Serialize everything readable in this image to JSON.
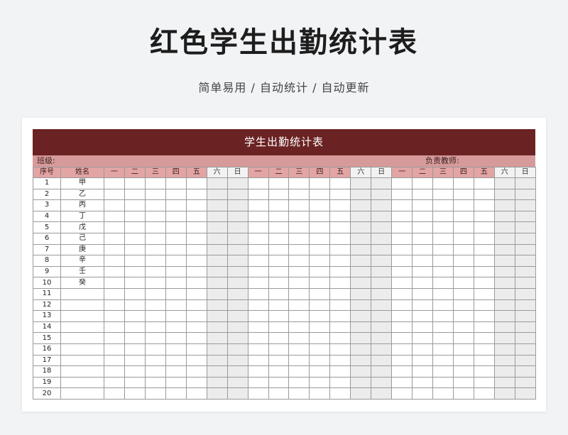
{
  "page": {
    "title": "红色学生出勤统计表",
    "subtitle": "简单易用  /  自动统计  /  自动更新"
  },
  "sheet": {
    "title": "学生出勤统计表",
    "class_label": "班级:",
    "teacher_label": "负责教师:",
    "header_index": "序号",
    "header_name": "姓名",
    "weeks": [
      [
        "一",
        "二",
        "三",
        "四",
        "五",
        "六",
        "日"
      ],
      [
        "一",
        "二",
        "三",
        "四",
        "五",
        "六",
        "日"
      ],
      [
        "一",
        "二",
        "三",
        "四",
        "五",
        "六",
        "日"
      ]
    ],
    "weekend_marker": [
      "六",
      "日"
    ],
    "rows": [
      {
        "no": "1",
        "name": "甲"
      },
      {
        "no": "2",
        "name": "乙"
      },
      {
        "no": "3",
        "name": "丙"
      },
      {
        "no": "4",
        "name": "丁"
      },
      {
        "no": "5",
        "name": "戊"
      },
      {
        "no": "6",
        "name": "己"
      },
      {
        "no": "7",
        "name": "庚"
      },
      {
        "no": "8",
        "name": "辛"
      },
      {
        "no": "9",
        "name": "壬"
      },
      {
        "no": "10",
        "name": "癸"
      },
      {
        "no": "11",
        "name": ""
      },
      {
        "no": "12",
        "name": ""
      },
      {
        "no": "13",
        "name": ""
      },
      {
        "no": "14",
        "name": ""
      },
      {
        "no": "15",
        "name": ""
      },
      {
        "no": "16",
        "name": ""
      },
      {
        "no": "17",
        "name": ""
      },
      {
        "no": "18",
        "name": ""
      },
      {
        "no": "19",
        "name": ""
      },
      {
        "no": "20",
        "name": ""
      }
    ]
  },
  "colors": {
    "title_bar": "#6b2222",
    "info_bar": "#d79a9a",
    "header_cell": "#e3a4a4",
    "weekend_cell": "#ececec"
  }
}
